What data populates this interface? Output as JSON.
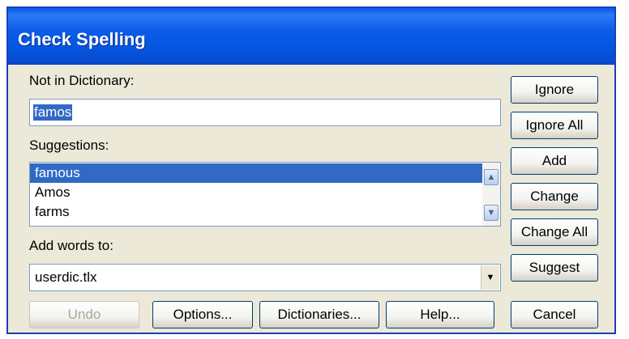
{
  "window": {
    "title": "Check Spelling"
  },
  "not_in_dictionary": {
    "label": "Not in Dictionary:",
    "value": "famos"
  },
  "suggestions": {
    "label": "Suggestions:",
    "items": [
      "famous",
      "Amos",
      "farms"
    ],
    "selected_index": 0
  },
  "add_words_to": {
    "label": "Add words to:",
    "value": "userdic.tlx"
  },
  "side_buttons": {
    "ignore": "Ignore",
    "ignore_all": "Ignore All",
    "add": "Add",
    "change": "Change",
    "change_all": "Change All",
    "suggest": "Suggest"
  },
  "bottom_buttons": {
    "undo": "Undo",
    "options": "Options...",
    "dictionaries": "Dictionaries...",
    "help": "Help...",
    "cancel": "Cancel"
  },
  "colors": {
    "title_bar": "#0a58e6",
    "selection": "#316ac5",
    "dialog_bg": "#ece9d8"
  },
  "icons": {
    "scroll_up": "scroll-up-icon",
    "scroll_down": "scroll-down-icon",
    "dropdown": "chevron-down-icon"
  }
}
